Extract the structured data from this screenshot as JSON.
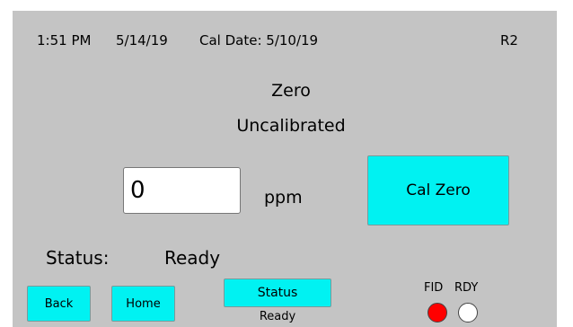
{
  "header": {
    "time": "1:51 PM",
    "date": "5/14/19",
    "cal_date": "Cal Date: 5/10/19",
    "revision": "R2"
  },
  "title": {
    "mode": "Zero",
    "state": "Uncalibrated"
  },
  "reading": {
    "value": "0",
    "units": "ppm"
  },
  "actions": {
    "cal_zero_label": "Cal Zero"
  },
  "status": {
    "label": "Status:",
    "value": "Ready"
  },
  "footer": {
    "back_label": "Back",
    "home_label": "Home",
    "status_label": "Status",
    "status_sub": "Ready"
  },
  "indicators": {
    "fid_label": "FID",
    "rdy_label": "RDY",
    "fid_color": "#ff0000",
    "rdy_color": "#ffffff"
  },
  "colors": {
    "screen_bg": "#c4c4c4",
    "button": "#00f2f2"
  }
}
